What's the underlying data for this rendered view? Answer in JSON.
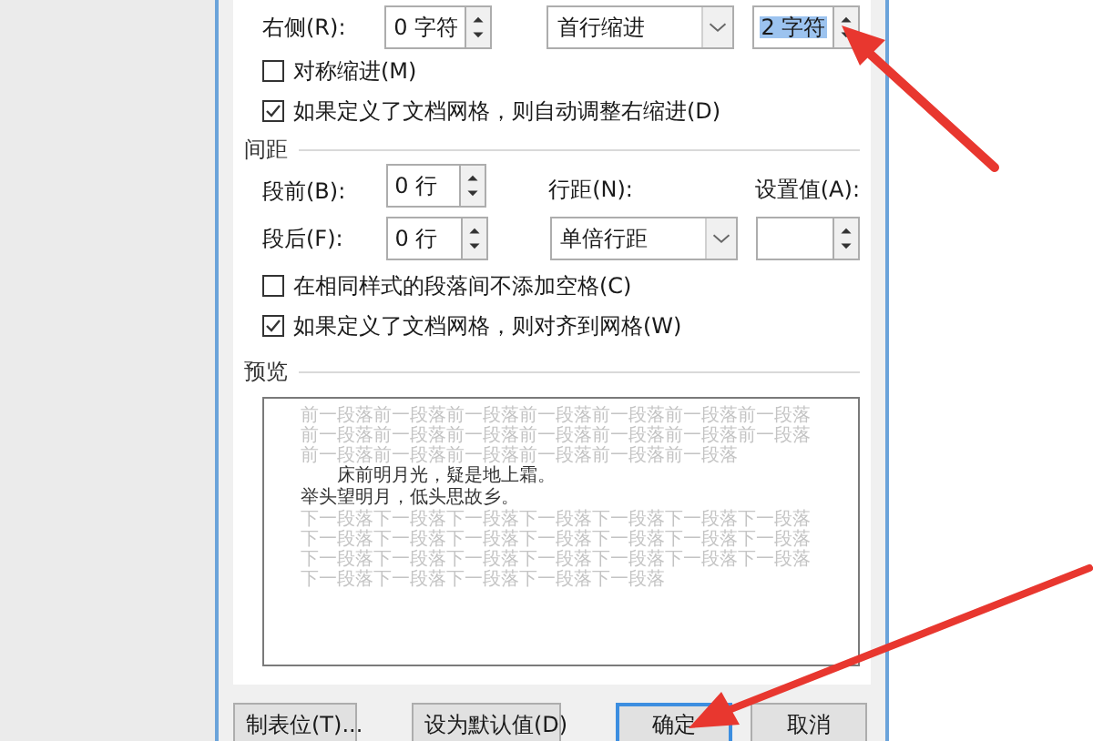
{
  "indent_row": {
    "label": "右侧(R):",
    "value": "0 字符",
    "special_value": "首行缩进",
    "by_value": "2 字符",
    "by_selected": true
  },
  "indent_checks": [
    {
      "label": "对称缩进(M)",
      "checked": false
    },
    {
      "label": "如果定义了文档网格，则自动调整右缩进(D)",
      "checked": true
    }
  ],
  "spacing": {
    "title": "间距",
    "before_label": "段前(B):",
    "before_value": "0 行",
    "after_label": "段后(F):",
    "after_value": "0 行",
    "line_spacing_label": "行距(N):",
    "line_spacing_value": "单倍行距",
    "at_label": "设置值(A):"
  },
  "spacing_checks": [
    {
      "label": "在相同样式的段落间不添加空格(C)",
      "checked": false
    },
    {
      "label": "如果定义了文档网格，则对齐到网格(W)",
      "checked": true
    }
  ],
  "preview": {
    "title": "预览",
    "before_text": "前一段落前一段落前一段落前一段落前一段落前一段落前一段落前一段落前一段落前一段落前一段落前一段落前一段落前一段落前一段落前一段落前一段落前一段落前一段落前一段落",
    "sample_lines": [
      "床前明月光，疑是地上霜。",
      "举头望明月，低头思故乡。"
    ],
    "after_text": "下一段落下一段落下一段落下一段落下一段落下一段落下一段落下一段落下一段落下一段落下一段落下一段落下一段落下一段落下一段落下一段落下一段落下一段落下一段落下一段落下一段落下一段落下一段落下一段落下一段落下一段落"
  },
  "buttons": [
    {
      "label": "制表位(T)...",
      "default": false
    },
    {
      "label": "设为默认值(D)",
      "default": false
    },
    {
      "label": "确定",
      "default": true
    },
    {
      "label": "取消",
      "default": false
    }
  ]
}
